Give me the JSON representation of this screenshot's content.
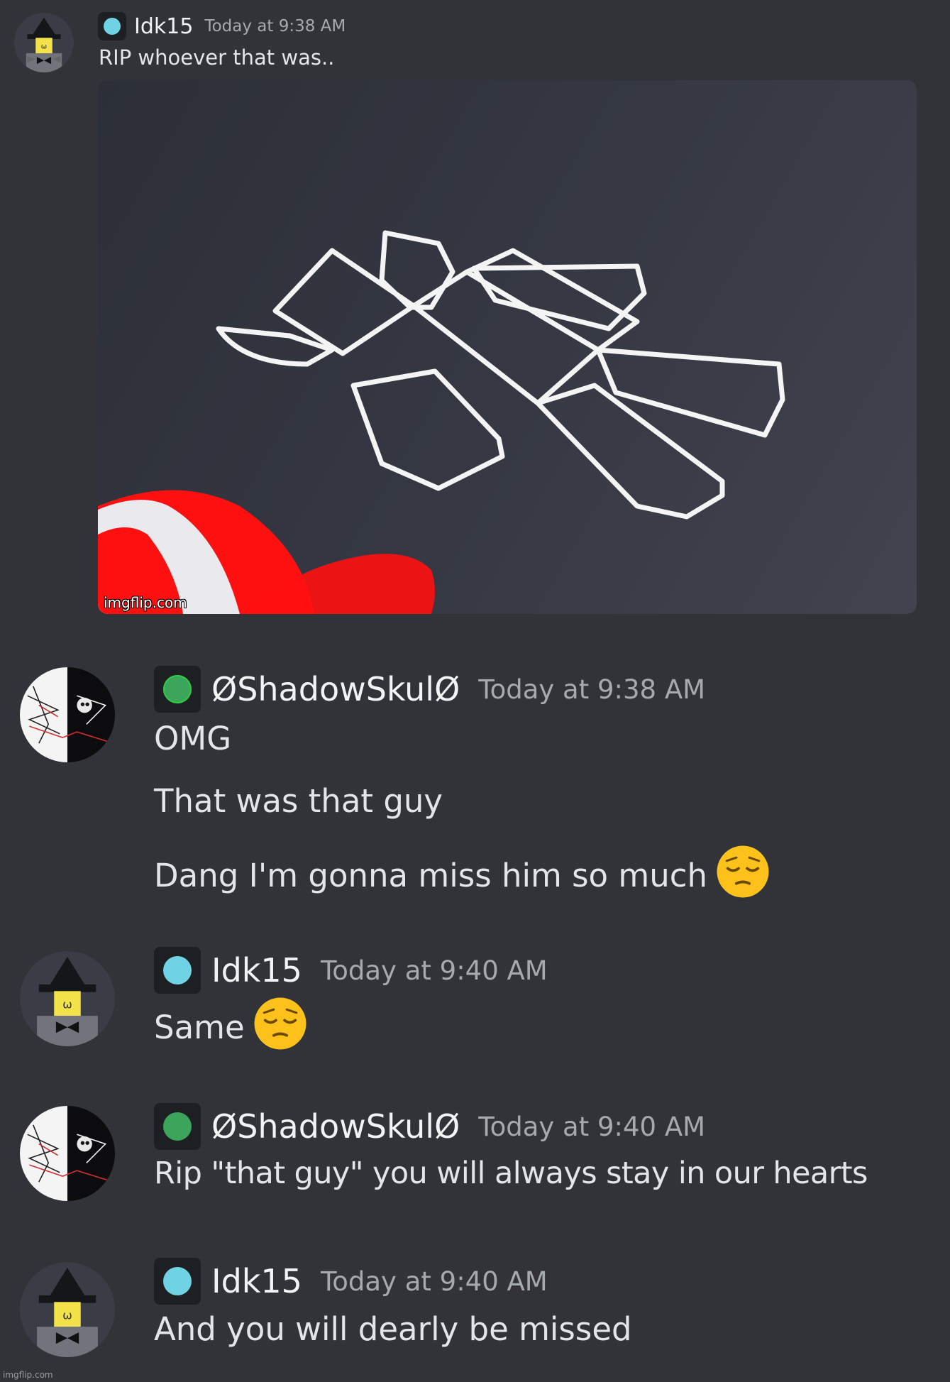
{
  "messages": [
    {
      "username": "Idk15",
      "timestamp": "Today at 9:38 AM",
      "status_color": "#6fd3e3",
      "lines": [
        "RIP whoever that was.."
      ],
      "attachment": {
        "watermark": "imgflip.com"
      }
    },
    {
      "username": "ØShadowSkulØ",
      "timestamp": "Today at 9:38 AM",
      "status_color": "#3ba55c",
      "lines": [
        "OMG",
        "That was that guy",
        "Dang I'm gonna miss him so much"
      ]
    },
    {
      "username": "Idk15",
      "timestamp": "Today at 9:40 AM",
      "status_color": "#6fd3e3",
      "lines": [
        "Same"
      ]
    },
    {
      "username": "ØShadowSkulØ",
      "timestamp": "Today at 9:40 AM",
      "status_color": "#3ba55c",
      "lines": [
        "Rip \"that guy\" you will always stay in our hearts"
      ]
    },
    {
      "username": "Idk15",
      "timestamp": "Today at 9:40 AM",
      "status_color": "#6fd3e3",
      "lines": [
        "And you will dearly be missed"
      ]
    }
  ],
  "emoji": "pensive-face",
  "footer_watermark": "imgflip.com"
}
